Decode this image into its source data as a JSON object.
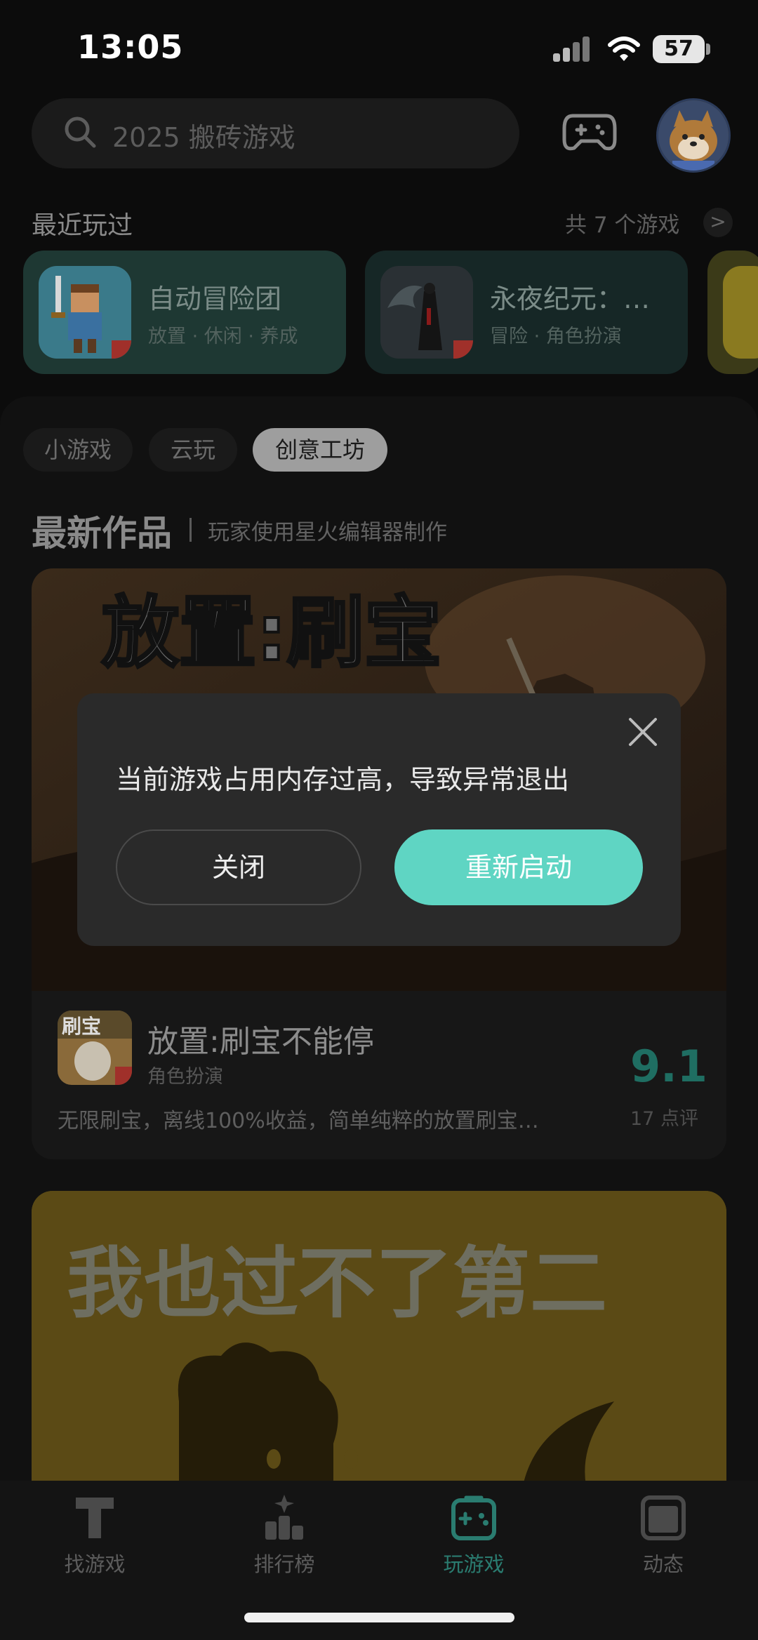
{
  "status_bar": {
    "time": "13:05",
    "battery": "57"
  },
  "search": {
    "placeholder": "2025 搬砖游戏"
  },
  "recent": {
    "title": "最近玩过",
    "count_label": "共 7 个游戏",
    "chevron": ">",
    "items": [
      {
        "name": "自动冒险团",
        "tags": "放置 · 休闲 · 养成"
      },
      {
        "name": "永夜纪元：…",
        "tags": "冒险 · 角色扮演"
      }
    ]
  },
  "tabs": [
    {
      "label": "小游戏"
    },
    {
      "label": "云玩"
    },
    {
      "label": "创意工坊"
    }
  ],
  "section": {
    "title": "最新作品",
    "subtitle": "玩家使用星火编辑器制作"
  },
  "featured_game": {
    "name": "放置:刷宝不能停",
    "genre": "角色扮演",
    "score": "9.1",
    "reviews": "17 点评",
    "description": "无限刷宝，离线100%收益，简单纯粹的放置刷宝…",
    "banner_text_line1": "放置:刷宝",
    "icon_text": "刷宝"
  },
  "second_game": {
    "banner_text": "我也过不了第二"
  },
  "modal": {
    "message": "当前游戏占用内存过高，导致异常退出",
    "close_label": "关闭",
    "restart_label": "重新启动"
  },
  "bottom_nav": [
    {
      "label": "找游戏",
      "icon": "find-games-icon"
    },
    {
      "label": "排行榜",
      "icon": "ranking-icon"
    },
    {
      "label": "玩游戏",
      "icon": "gamepad-icon"
    },
    {
      "label": "动态",
      "icon": "feed-icon"
    }
  ],
  "colors": {
    "accent": "#5fd5c3",
    "modal_bg": "#2a2a2a",
    "background": "#0c0c0c"
  }
}
